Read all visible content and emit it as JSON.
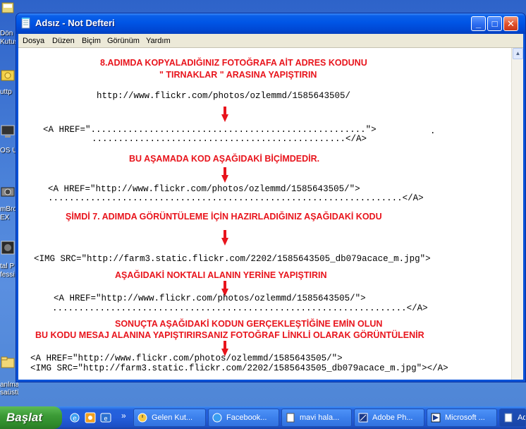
{
  "window": {
    "title": "Adsız - Not Defteri",
    "minimize_glyph": "_",
    "maximize_glyph": "□",
    "close_glyph": "✕"
  },
  "menu": [
    "Dosya",
    "Düzen",
    "Biçim",
    "Görünüm",
    "Yardım"
  ],
  "desktop_icons": [
    "Dön",
    "Kutus",
    "uttp",
    "OS Ut",
    "mBro",
    "EX",
    "tal P",
    "fessi",
    "anlmayan",
    "saüstü"
  ],
  "content": {
    "step8_line1": "8.ADIMDA KOPYALADIĞINIZ FOTOĞRAFA AİT ADRES KODUNU",
    "step8_line2": "\" TIRNAKLAR \" ARASINA YAPIŞTIRIN",
    "url1": "http://www.flickr.com/photos/ozlemmd/1585643505/",
    "ahref_dotted": "<A HREF=\"....................................................\">",
    "ahref_dotted_trail": ".",
    "dotted_close1": "................................................</A>",
    "stage_note": "BU AŞAMADA KOD AŞAĞIDAKİ BİÇİMDEDİR.",
    "ahref_full1": "<A HREF=\"http://www.flickr.com/photos/ozlemmd/1585643505/\">",
    "dotted_close2": "...................................................................</A>",
    "step7_note": "ŞİMDİ 7. ADIMDA GÖRÜNTÜLEME İÇİN HAZIRLADIĞINIZ AŞAĞIDAKİ KODU",
    "img_tag": "<IMG SRC=\"http://farm3.static.flickr.com/2202/1585643505_db079acace_m.jpg\">",
    "paste_note": "AŞAĞIDAKİ NOKTALI ALANIN YERİNE YAPIŞTIRIN",
    "ahref_full2": "<A HREF=\"http://www.flickr.com/photos/ozlemmd/1585643505/\">",
    "dotted_close3": "...................................................................</A>",
    "result_note1": "SONUÇTA AŞAĞIDAKİ KODUN GERÇEKLEŞTİĞİNE EMİN OLUN",
    "result_note2": "BU KODU MESAJ ALANINA YAPIŞTIRIRSANIZ FOTOĞRAF LİNKLİ OLARAK GÖRÜNTÜLENİR",
    "final_ahref": "<A HREF=\"http://www.flickr.com/photos/ozlemmd/1585643505/\">",
    "final_img": "<IMG SRC=\"http://farm3.static.flickr.com/2202/1585643505_db079acace_m.jpg\"></A>"
  },
  "taskbar": {
    "start_label": "Başlat",
    "overflow_glyph": "»",
    "buttons": [
      "Gelen Kut...",
      "Facebook...",
      "mavi hala...",
      "Adobe Ph...",
      "Microsoft ...",
      "Ad"
    ]
  },
  "colors": {
    "instruction_red": "#e8141c",
    "title_blue": "#0055e5",
    "start_green": "#3c9b37"
  }
}
